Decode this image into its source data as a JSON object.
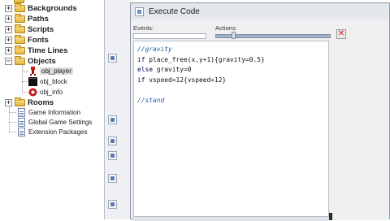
{
  "resource_tree": {
    "folders": [
      {
        "label": "Backgrounds"
      },
      {
        "label": "Paths"
      },
      {
        "label": "Scripts"
      },
      {
        "label": "Fonts"
      },
      {
        "label": "Time Lines"
      },
      {
        "label": "Objects"
      },
      {
        "label": "Rooms"
      }
    ],
    "objects": [
      {
        "label": "obj_player",
        "selected": true
      },
      {
        "label": "obj_block"
      },
      {
        "label": "obj_info"
      }
    ],
    "documents": [
      {
        "label": "Game Information"
      },
      {
        "label": "Global Game Settings"
      },
      {
        "label": "Extension Packages"
      }
    ]
  },
  "code_window": {
    "title": "Execute Code",
    "events_label": "Events:",
    "actions_label": "Actions:",
    "close_glyph": "✕",
    "code_lines": [
      {
        "parts": [
          {
            "text": "//gravity",
            "cls": "c-comment"
          }
        ]
      },
      {
        "parts": [
          {
            "text": "if",
            "cls": "c-key"
          },
          {
            "text": " place_free(x,y+1){gravity=0.5}",
            "cls": "c-code"
          }
        ]
      },
      {
        "parts": [
          {
            "text": "else",
            "cls": "c-key"
          },
          {
            "text": " gravity=0",
            "cls": "c-code"
          }
        ]
      },
      {
        "parts": [
          {
            "text": "if",
            "cls": "c-key"
          },
          {
            "text": " vspeed=12{vspeed=12}",
            "cls": "c-code"
          }
        ]
      },
      {
        "parts": [
          {
            "text": "",
            "cls": "c-code"
          }
        ]
      },
      {
        "parts": [
          {
            "text": "//stand",
            "cls": "c-comment"
          }
        ]
      }
    ]
  },
  "colors": {
    "comment": "#1a5fb0",
    "keyword": "#0a0a5a",
    "folder": "#e2b43c",
    "close_x": "#d01818"
  }
}
